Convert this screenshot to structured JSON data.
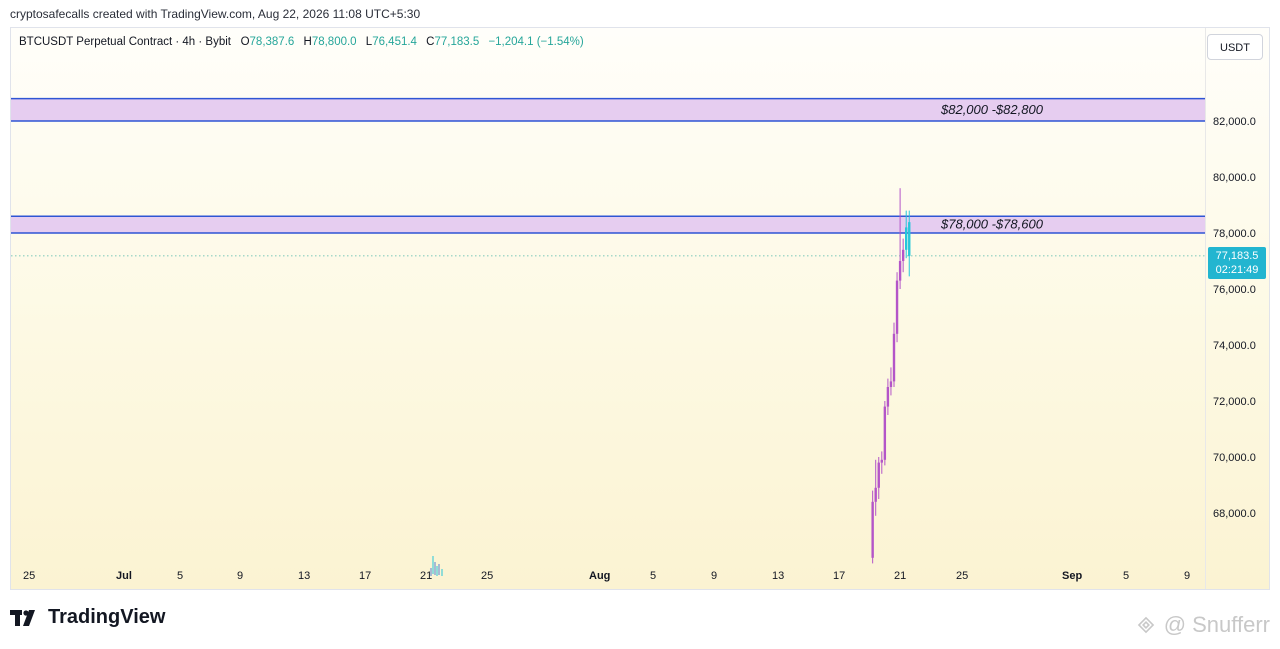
{
  "header": {
    "credit": "cryptosafecalls created with TradingView.com, Aug 22, 2026 11:08 UTC+5:30"
  },
  "legend": {
    "symbol": "BTCUSDT Perpetual Contract · 4h · Bybit",
    "open_label": "O",
    "open": "78,387.6",
    "high_label": "H",
    "high": "78,800.0",
    "low_label": "L",
    "low": "76,451.4",
    "close_label": "C",
    "close": "77,183.5",
    "change": "−1,204.1 (−1.54%)"
  },
  "currency_button": "USDT",
  "price_tag": {
    "price": "77,183.5",
    "countdown": "02:21:49"
  },
  "footer": {
    "brand": "TradingView"
  },
  "watermark": "@ Snufferr",
  "colors": {
    "zone_fill": "#e6cdf0",
    "zone_border": "#2f55d4",
    "candle_up": "#26c6da",
    "candle_down": "#b455c8",
    "price_tag": "#22b5d0",
    "background_top": "#fffefa",
    "background_bottom": "#fbf3d2"
  },
  "chart_data": {
    "type": "candlestick",
    "timeframe": "4h",
    "y_ticks": [
      68000,
      70000,
      72000,
      74000,
      76000,
      78000,
      80000,
      82000
    ],
    "y_tick_labels": [
      "68,000.0",
      "70,000.0",
      "72,000.0",
      "74,000.0",
      "76,000.0",
      "78,000.0",
      "80,000.0",
      "82,000.0"
    ],
    "x_tick_labels": [
      "25",
      "Jul",
      "5",
      "9",
      "13",
      "17",
      "21",
      "25",
      "Aug",
      "5",
      "9",
      "13",
      "17",
      "21",
      "25",
      "Sep",
      "5",
      "9"
    ],
    "zones": [
      {
        "label": "$82,000 -$82,800",
        "low": 82000,
        "high": 82800
      },
      {
        "label": "$78,000 -$78,600",
        "low": 78000,
        "high": 78600
      }
    ],
    "last_price": 77183.5,
    "candles_aug": [
      {
        "day": 19.6,
        "o": 66400,
        "h": 68800,
        "l": 66200,
        "c": 68400
      },
      {
        "day": 19.8,
        "o": 68400,
        "h": 69900,
        "l": 67900,
        "c": 68900
      },
      {
        "day": 20.0,
        "o": 68900,
        "h": 70000,
        "l": 68500,
        "c": 69800
      },
      {
        "day": 20.2,
        "o": 69800,
        "h": 70200,
        "l": 69400,
        "c": 69900
      },
      {
        "day": 20.4,
        "o": 69900,
        "h": 72000,
        "l": 69700,
        "c": 71800
      },
      {
        "day": 20.6,
        "o": 71800,
        "h": 72800,
        "l": 71500,
        "c": 72500
      },
      {
        "day": 20.8,
        "o": 72500,
        "h": 73200,
        "l": 72200,
        "c": 72700
      },
      {
        "day": 21.0,
        "o": 72700,
        "h": 74800,
        "l": 72500,
        "c": 74400
      },
      {
        "day": 21.2,
        "o": 74400,
        "h": 76600,
        "l": 74100,
        "c": 76300
      },
      {
        "day": 21.4,
        "o": 76300,
        "h": 79600,
        "l": 76000,
        "c": 77000
      },
      {
        "day": 21.6,
        "o": 77000,
        "h": 77800,
        "l": 76600,
        "c": 77400
      },
      {
        "day": 21.8,
        "o": 77400,
        "h": 78800,
        "l": 77100,
        "c": 78200
      },
      {
        "day": 22.0,
        "o": 78387.6,
        "h": 78800,
        "l": 76451.4,
        "c": 77183.5
      }
    ]
  }
}
